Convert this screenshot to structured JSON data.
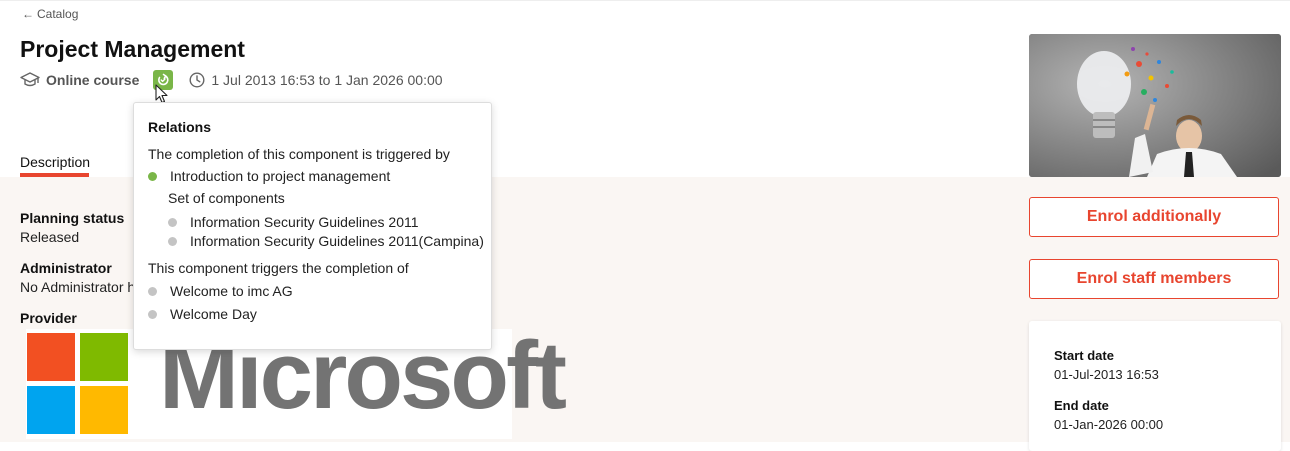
{
  "nav": {
    "back_arrow": "←",
    "back_label": "Catalog"
  },
  "course": {
    "title": "Project Management",
    "type_label": "Online course",
    "date_range": "1 Jul 2013 16:53 to 1 Jan 2026 00:00"
  },
  "tabs": [
    {
      "label": "Description"
    }
  ],
  "details": {
    "planning_status_label": "Planning status",
    "planning_status_value": "Released",
    "administrator_label": "Administrator",
    "administrator_value": "No Administrator h",
    "provider_label": "Provider",
    "provider_logo_text": "Microsoft"
  },
  "actions": {
    "enrol_additionally": "Enrol additionally",
    "enrol_staff": "Enrol staff members"
  },
  "dates": {
    "start_label": "Start date",
    "start_value": "01-Jul-2013 16:53",
    "end_label": "End date",
    "end_value": "01-Jan-2026 00:00"
  },
  "relations": {
    "title": "Relations",
    "triggered_by_heading": "The completion of this component is triggered by",
    "triggered_by": [
      {
        "label": "Introduction to project management",
        "status": "green"
      }
    ],
    "set_heading": "Set of components",
    "set_items": [
      {
        "label": "Information Security Guidelines 2011",
        "status": "grey"
      },
      {
        "label": "Information Security Guidelines 2011(Campina)",
        "status": "grey"
      }
    ],
    "triggers_heading": "This component triggers the completion of",
    "triggers": [
      {
        "label": "Welcome to imc AG",
        "status": "grey"
      },
      {
        "label": "Welcome Day",
        "status": "grey"
      }
    ]
  },
  "colors": {
    "accent": "#e8452f",
    "relation_green": "#7ab648",
    "neutral_dot": "#c4c4c4",
    "content_background": "#faf6f3"
  },
  "icons": {
    "course_type": "graduation-cap-icon",
    "relation": "relation-icon",
    "date": "clock-icon"
  }
}
